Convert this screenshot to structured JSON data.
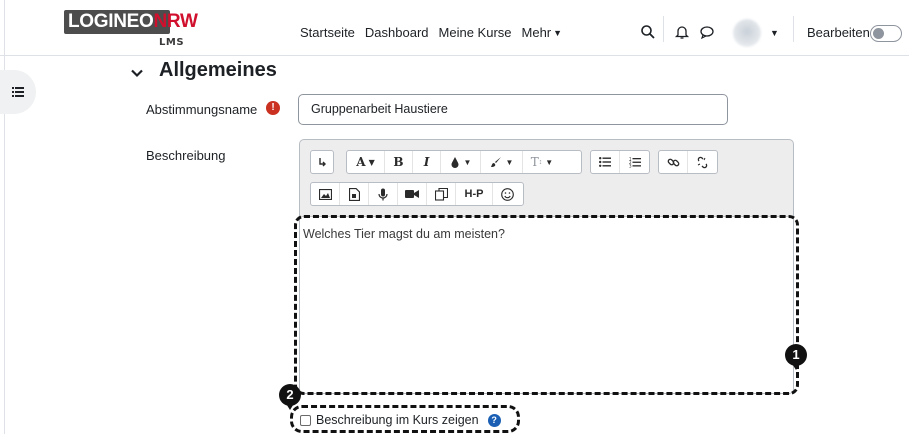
{
  "header": {
    "logo_main": "LOGINEO",
    "logo_accent": "NRW",
    "logo_sub": "LMS",
    "nav": [
      "Startseite",
      "Dashboard",
      "Meine Kurse",
      "Mehr"
    ],
    "edit_label": "Bearbeiten",
    "edit_mode_on": false
  },
  "section": {
    "title": "Allgemeines"
  },
  "form": {
    "name_label": "Abstimmungsname",
    "name_value": "Gruppenarbeit Haustiere",
    "desc_label": "Beschreibung",
    "desc_text": "Welches Tier magst du am meisten?",
    "show_desc_label": "Beschreibung im Kurs zeigen",
    "show_desc_checked": false
  },
  "toolbar": {
    "row1": [
      "undo-icon",
      "font-size-icon",
      "bold-icon",
      "italic-icon",
      "text-color-icon",
      "background-color-icon",
      "font-style-icon",
      "bullet-list-icon",
      "numbered-list-icon",
      "link-icon",
      "unlink-icon"
    ],
    "row2": [
      "image-icon",
      "media-icon",
      "microphone-icon",
      "video-icon",
      "copy-icon",
      "h5p-icon",
      "emoji-icon"
    ],
    "a_label": "A",
    "b_label": "B",
    "i_label": "I",
    "h5p_label": "H-P"
  },
  "annotations": {
    "marker1": "1",
    "marker2": "2"
  }
}
